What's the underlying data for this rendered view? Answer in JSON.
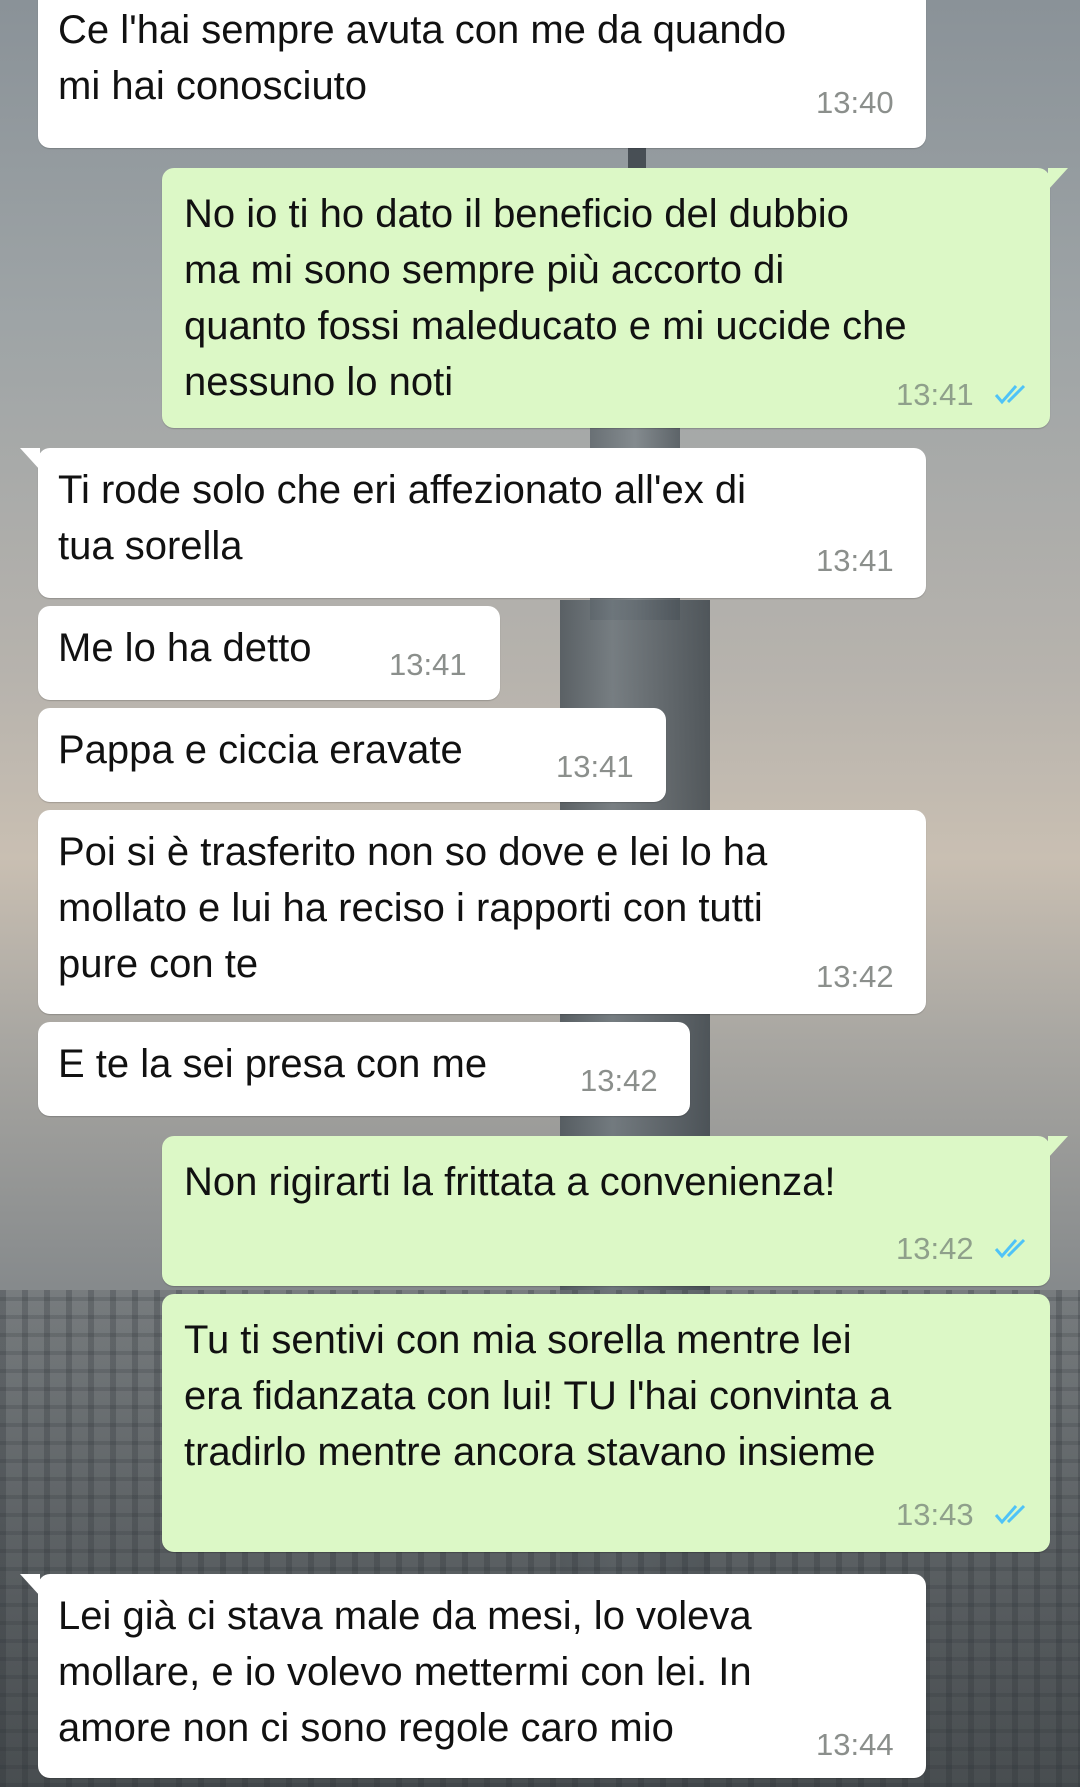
{
  "messages": [
    {
      "direction": "in",
      "text": "Ce l'hai sempre avuta con me da quando\nmi hai conosciuto",
      "time": "13:40"
    },
    {
      "direction": "out",
      "text": "No io ti ho dato il beneficio del dubbio\nma mi sono sempre più accorto di\nquanto fossi maleducato e mi uccide che\nnessuno lo noti",
      "time": "13:41",
      "status": "read"
    },
    {
      "direction": "in",
      "text": "Ti rode solo che eri affezionato all'ex di\ntua sorella",
      "time": "13:41"
    },
    {
      "direction": "in",
      "text": "Me lo ha detto",
      "time": "13:41"
    },
    {
      "direction": "in",
      "text": "Pappa e ciccia eravate",
      "time": "13:41"
    },
    {
      "direction": "in",
      "text": "Poi si è trasferito non so dove e lei lo ha\nmollato e lui ha reciso i rapporti con tutti\npure con te",
      "time": "13:42"
    },
    {
      "direction": "in",
      "text": "E te la sei presa con me",
      "time": "13:42"
    },
    {
      "direction": "out",
      "text": "Non rigirarti la frittata a convenienza!",
      "time": "13:42",
      "status": "read"
    },
    {
      "direction": "out",
      "text": "Tu ti sentivi con mia sorella mentre lei\nera fidanzata con lui! TU l'hai convinta a\ntradirlo mentre ancora stavano insieme",
      "time": "13:43",
      "status": "read"
    },
    {
      "direction": "in",
      "text": "Lei già ci stava male da mesi, lo voleva\nmollare, e io volevo mettermi con lei. In\namore non ci sono regole caro mio",
      "time": "13:44"
    }
  ],
  "colors": {
    "incoming_bubble": "#ffffff",
    "outgoing_bubble": "#dcf8c6",
    "read_tick": "#4fc3f7"
  },
  "icons": {
    "read_receipt": "double-check-icon"
  }
}
